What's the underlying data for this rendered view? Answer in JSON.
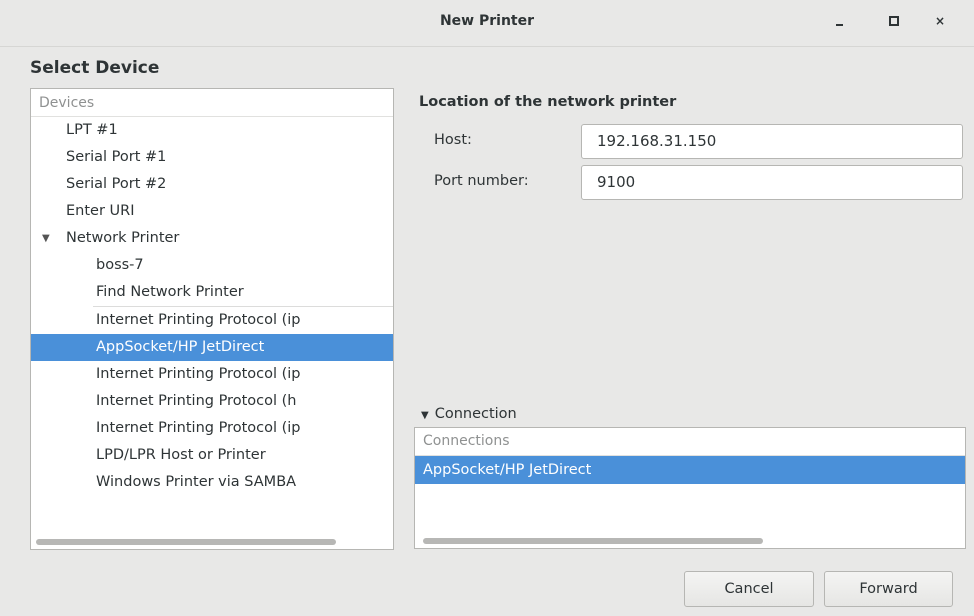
{
  "window": {
    "title": "New Printer",
    "controls": [
      "minimize-icon",
      "maximize-icon",
      "close-icon"
    ],
    "close_glyph": "×"
  },
  "heading": "Select Device",
  "devices": {
    "header": "Devices",
    "items": [
      {
        "label": "LPT #1",
        "level": 0,
        "selected": false
      },
      {
        "label": "Serial Port #1",
        "level": 0,
        "selected": false
      },
      {
        "label": "Serial Port #2",
        "level": 0,
        "selected": false
      },
      {
        "label": "Enter URI",
        "level": 0,
        "selected": false
      },
      {
        "label": "Network Printer",
        "level": 0,
        "selected": false,
        "expanded": true
      },
      {
        "label": "boss-7",
        "level": 1,
        "selected": false
      },
      {
        "label": "Find Network Printer",
        "level": 1,
        "selected": false
      },
      {
        "label": "Internet Printing Protocol (ip",
        "level": 1,
        "selected": false
      },
      {
        "label": "AppSocket/HP JetDirect",
        "level": 1,
        "selected": true
      },
      {
        "label": "Internet Printing Protocol (ip",
        "level": 1,
        "selected": false
      },
      {
        "label": "Internet Printing Protocol (h",
        "level": 1,
        "selected": false
      },
      {
        "label": "Internet Printing Protocol (ip",
        "level": 1,
        "selected": false
      },
      {
        "label": "LPD/LPR Host or Printer",
        "level": 1,
        "selected": false
      },
      {
        "label": "Windows Printer via SAMBA",
        "level": 1,
        "selected": false
      }
    ]
  },
  "location": {
    "title": "Location of the network printer",
    "host_label": "Host:",
    "host_value": "192.168.31.150",
    "port_label": "Port number:",
    "port_value": "9100"
  },
  "connection": {
    "expander_label": "Connection",
    "header": "Connections",
    "items": [
      "AppSocket/HP JetDirect"
    ]
  },
  "buttons": {
    "cancel": "Cancel",
    "forward": "Forward"
  },
  "colors": {
    "selection": "#4a90d9",
    "background": "#e8e8e7"
  }
}
